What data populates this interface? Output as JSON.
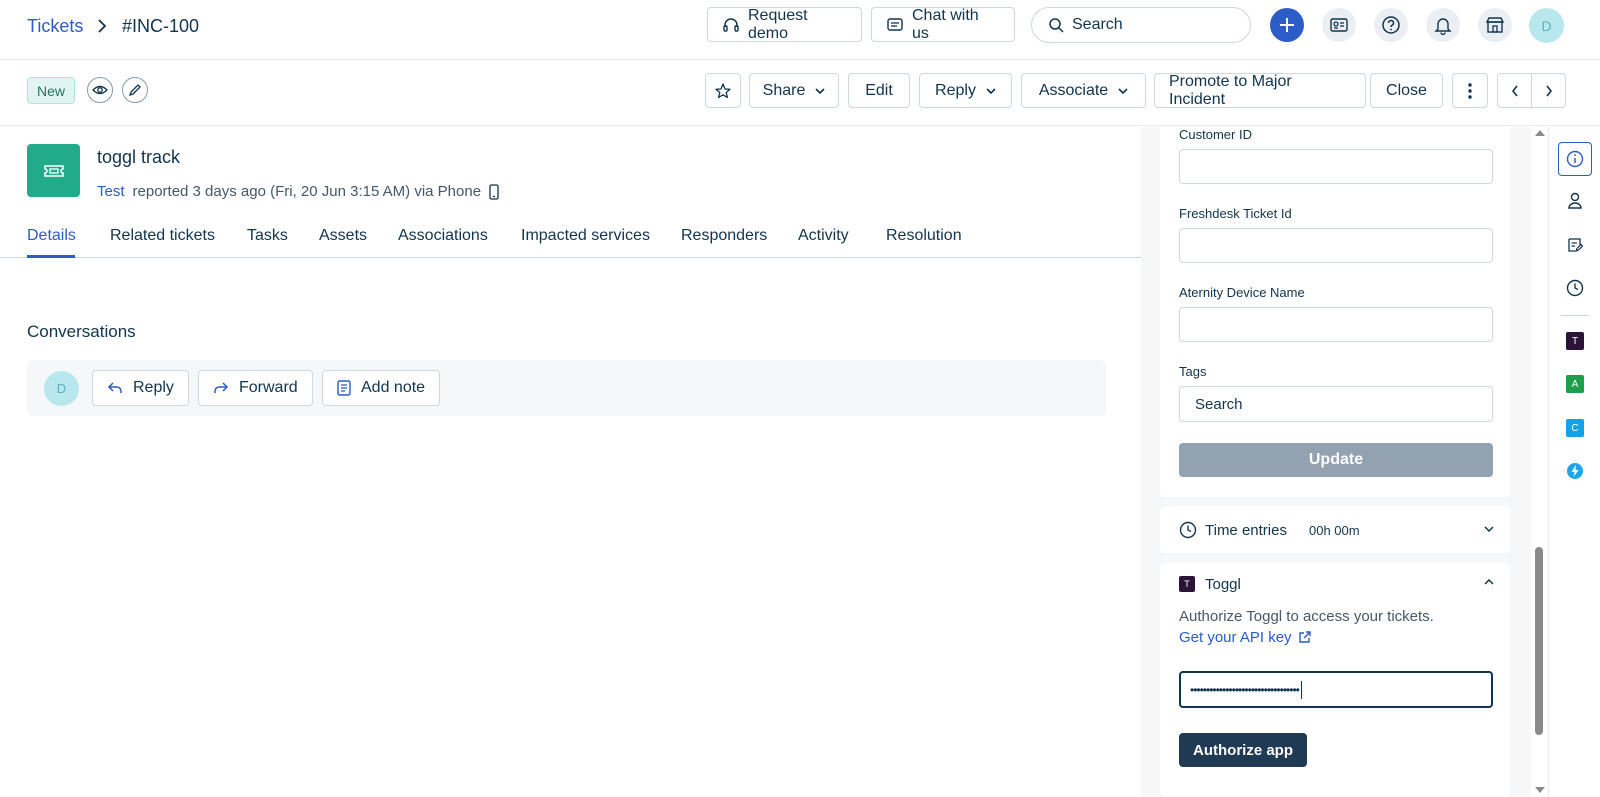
{
  "breadcrumb": {
    "parent": "Tickets",
    "current": "#INC-100"
  },
  "topbar": {
    "request_demo": "Request demo",
    "chat_with_us": "Chat with us",
    "search_placeholder": "Search",
    "avatar_initial": "D"
  },
  "toolbar": {
    "status": "New",
    "share": "Share",
    "edit": "Edit",
    "reply": "Reply",
    "associate": "Associate",
    "promote": "Promote to Major Incident",
    "close": "Close"
  },
  "ticket": {
    "title": "toggl track",
    "requester": "Test",
    "meta": "reported 3 days ago (Fri, 20 Jun 3:15 AM) via Phone"
  },
  "tabs": [
    {
      "label": "Details"
    },
    {
      "label": "Related tickets"
    },
    {
      "label": "Tasks"
    },
    {
      "label": "Assets"
    },
    {
      "label": "Associations"
    },
    {
      "label": "Impacted services"
    },
    {
      "label": "Responders"
    },
    {
      "label": "Activity"
    },
    {
      "label": "Resolution"
    }
  ],
  "conversations": {
    "title": "Conversations",
    "avatar_initial": "D",
    "reply": "Reply",
    "forward": "Forward",
    "add_note": "Add note"
  },
  "properties": {
    "customer_id_label": "Customer ID",
    "freshdesk_label": "Freshdesk Ticket Id",
    "aternity_label": "Aternity Device Name",
    "tags_label": "Tags",
    "tags_placeholder": "Search",
    "update": "Update"
  },
  "time_entries": {
    "label": "Time entries",
    "value": "00h 00m"
  },
  "toggl": {
    "title": "Toggl",
    "description": "Authorize Toggl to access your tickets.",
    "api_link": "Get your API key",
    "api_key_value": "••••••••••••••••••••••••••••••••••",
    "authorize": "Authorize app"
  },
  "rail_apps": [
    {
      "letter": "T",
      "color": "#2c1338"
    },
    {
      "letter": "A",
      "color": "#1e9e4a"
    },
    {
      "letter": "C",
      "color": "#10a3e8"
    }
  ],
  "colors": {
    "accent": "#2c5cc5",
    "teal": "#22ab8b",
    "authorize_btn": "#1f3a52"
  }
}
